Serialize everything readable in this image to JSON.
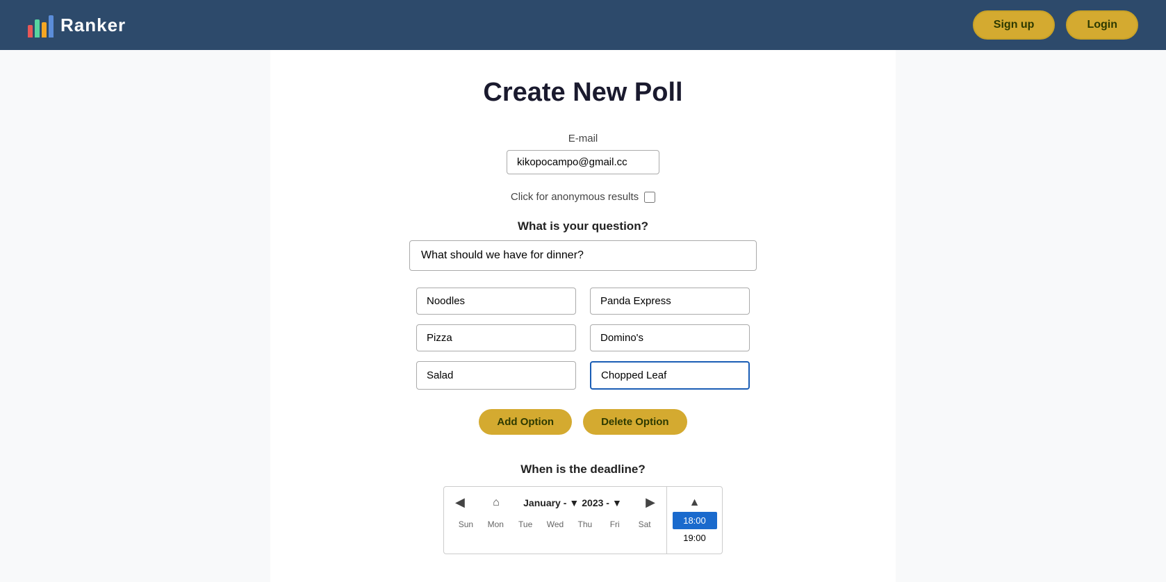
{
  "header": {
    "logo_label": "Ranker",
    "signup_label": "Sign up",
    "login_label": "Login"
  },
  "page": {
    "title": "Create New Poll"
  },
  "form": {
    "email_label": "E-mail",
    "email_value": "kikopocampo@gmail.cc",
    "anonymous_label": "Click for anonymous results",
    "question_label": "What is your question?",
    "question_value": "What should we have for dinner?",
    "options": [
      {
        "left": "Noodles",
        "right": "Panda Express"
      },
      {
        "left": "Pizza",
        "right": "Domino's"
      },
      {
        "left": "Salad",
        "right": "Chopped Leaf"
      }
    ],
    "add_option_label": "Add Option",
    "delete_option_label": "Delete Option",
    "deadline_label": "When is the deadline?",
    "calendar": {
      "month": "January",
      "year": "2023",
      "days_header": [
        "Sun",
        "Mon",
        "Tue",
        "Wed",
        "Thu",
        "Fri",
        "Sat"
      ]
    },
    "time_selected": "18:00",
    "time_next": "19:00"
  },
  "icons": {
    "bar1_color": "#e85757",
    "bar2_color": "#57d4a0",
    "bar3_color": "#f5a623",
    "bar4_color": "#5b8dd9"
  }
}
